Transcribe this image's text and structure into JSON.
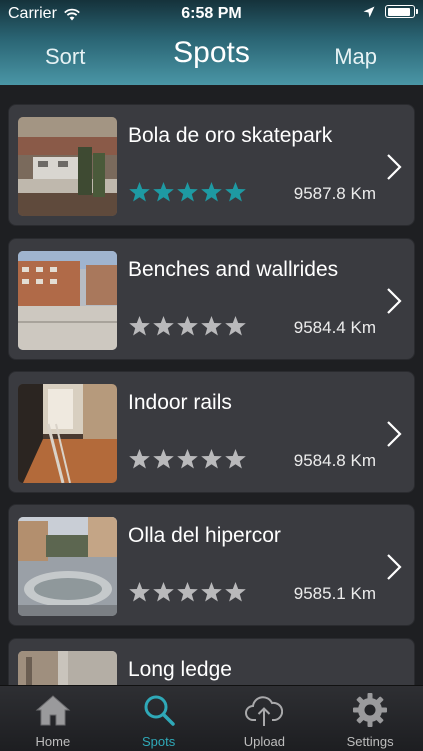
{
  "status_bar": {
    "carrier": "Carrier",
    "time": "6:58 PM",
    "battery_level": 0.95
  },
  "nav": {
    "left_label": "Sort",
    "title": "Spots",
    "right_label": "Map"
  },
  "spots": [
    {
      "name": "Bola de oro skatepark",
      "distance": "9587.8 Km",
      "rating": 5
    },
    {
      "name": "Benches and wallrides",
      "distance": "9584.4 Km",
      "rating": 0
    },
    {
      "name": "Indoor rails",
      "distance": "9584.8 Km",
      "rating": 0
    },
    {
      "name": "Olla del hipercor",
      "distance": "9585.1 Km",
      "rating": 0
    },
    {
      "name": "Long ledge",
      "distance": "",
      "rating": 0
    }
  ],
  "tabs": [
    {
      "label": "Home",
      "icon": "home-icon",
      "active": false
    },
    {
      "label": "Spots",
      "icon": "search-icon",
      "active": true
    },
    {
      "label": "Upload",
      "icon": "cloud-upload-icon",
      "active": false
    },
    {
      "label": "Settings",
      "icon": "gear-icon",
      "active": false
    }
  ],
  "colors": {
    "accent": "#2fa9b8",
    "star_filled": "#1e9aa3",
    "star_empty": "#b9b9bb",
    "card": "#3a3b40",
    "background": "#1e1f22"
  }
}
